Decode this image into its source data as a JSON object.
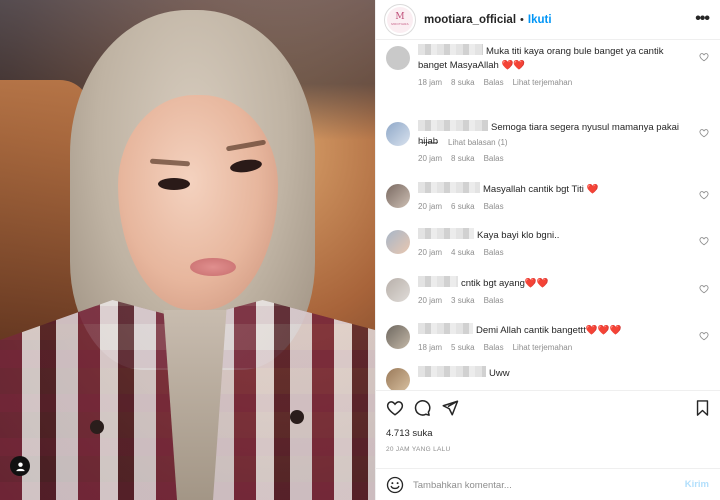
{
  "post": {
    "username": "mootiara_official",
    "separator": "•",
    "follow_label": "Ikuti",
    "more_label": "•••",
    "logo": {
      "monogram": "M",
      "subtext": "MOOTIARA",
      "color": "#c0507a"
    },
    "likes": "4.713 suka",
    "time_ago": "20 JAM YANG LALU"
  },
  "comments": [
    {
      "text": "Muka titi kaya orang bule banget ya cantik banget MasyaAllah ❤️❤️",
      "time": "18 jam",
      "likes": "8 suka",
      "reply": "Balas",
      "translate": "Lihat terjemahan",
      "avatar_color": "#c9c9c9"
    },
    {
      "text": "Semoga tiara segera nyusul mamanya pakai hijab",
      "time": "20 jam",
      "likes": "8 suka",
      "reply": "Balas",
      "avatar_color": "#8fa8c8"
    },
    {
      "text": "Masyallah cantik bgt Titi ❤️",
      "time": "20 jam",
      "likes": "6 suka",
      "reply": "Balas",
      "avatar_color": "#7a6a62"
    },
    {
      "text": "Kaya bayi klo bgni..",
      "time": "20 jam",
      "likes": "4 suka",
      "reply": "Balas",
      "avatar_color": "#a7b6c8"
    },
    {
      "text": "cntik bgt ayang❤️❤️",
      "time": "20 jam",
      "likes": "3 suka",
      "reply": "Balas",
      "avatar_color": "#b8b0aa"
    },
    {
      "text": "Demi Allah cantik bangettt❤️❤️❤️",
      "time": "18 jam",
      "likes": "5 suka",
      "reply": "Balas",
      "translate": "Lihat terjemahan",
      "avatar_color": "#6e6860"
    },
    {
      "text": "Uww",
      "avatar_color": "#9a7a5a"
    }
  ],
  "view_replies": "Lihat balasan (1)",
  "composer": {
    "placeholder": "Tambahkan komentar...",
    "post_label": "Kirim"
  },
  "colors": {
    "accent": "#0095f6",
    "muted": "#8e8e8e",
    "text": "#262626"
  }
}
